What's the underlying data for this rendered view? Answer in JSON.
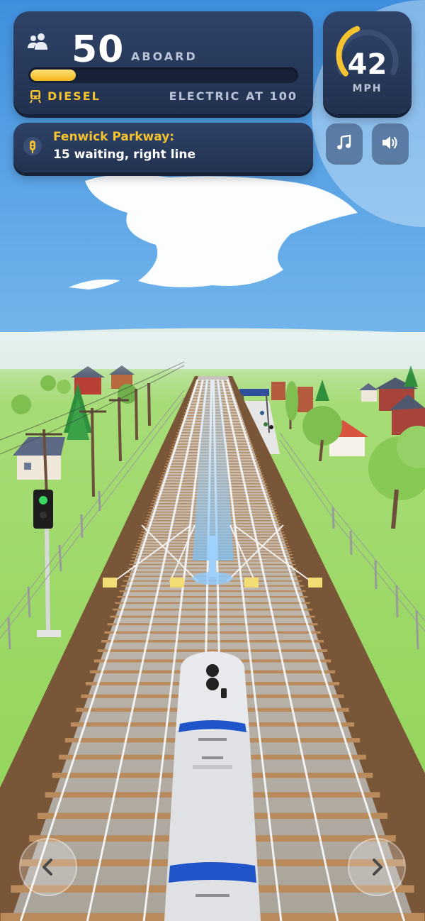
{
  "hud": {
    "passengers": "50",
    "passengers_label": "ABOARD",
    "progress": 0.17,
    "fuel_label": "DIESEL",
    "upgrade_label": "ELECTRIC AT 100"
  },
  "speed": {
    "value": "42",
    "unit": "MPH",
    "dial_fraction": 0.42
  },
  "station": {
    "name": "Fenwick Parkway:",
    "detail": "15 waiting, right line"
  },
  "controls": {
    "music_icon": "music-note-icon",
    "sound_icon": "speaker-icon",
    "left_icon": "chevron-left-icon",
    "right_icon": "chevron-right-icon"
  },
  "colors": {
    "accent": "#f5c330",
    "panel": "#2a3a5c",
    "train_stripe": "#1f55c8",
    "sky": "#7cc3f2",
    "grass": "#8fd457"
  }
}
